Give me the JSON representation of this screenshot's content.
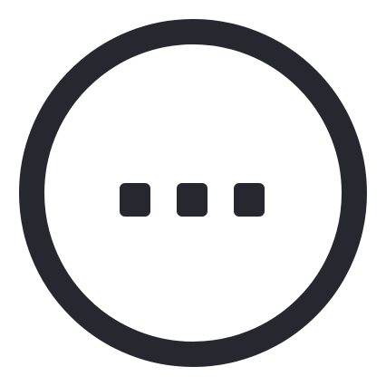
{
  "icon": {
    "name": "more-options-icon",
    "label": "",
    "stroke_color": "#272730",
    "background_color": "#ffffff"
  }
}
